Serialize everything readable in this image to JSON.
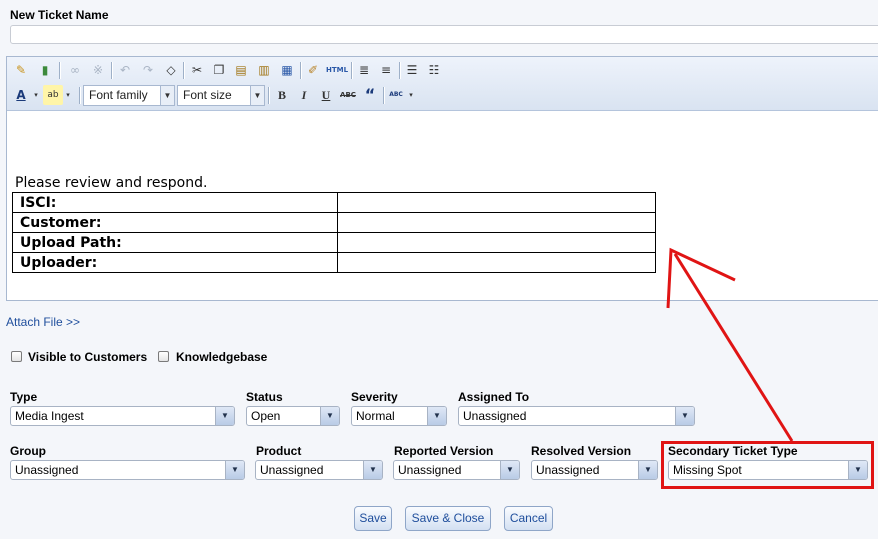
{
  "ticket_name": {
    "label": "New Ticket Name",
    "value": "",
    "placeholder": ""
  },
  "toolbar": {
    "row1_icons": [
      "pencil-icon",
      "books-icon",
      "link-icon",
      "unlink-icon",
      "undo-icon",
      "redo-icon",
      "eraser-icon",
      "cut-icon",
      "copy-icon",
      "paste-icon",
      "paste-text-icon",
      "paste-word-icon",
      "cleanup-brush-icon",
      "html-icon",
      "outdent-icon",
      "indent-icon",
      "bullet-list-icon",
      "numbered-list-icon"
    ],
    "font_family": "Font family",
    "font_size": "Font size",
    "html_label": "HTML",
    "bold": "B",
    "italic": "I",
    "underline": "U",
    "strikethrough": "ABC",
    "quote": "“",
    "spellcheck": "ABC"
  },
  "editor": {
    "intro": "Please review and respond.",
    "table_rows": [
      {
        "label": "ISCI:",
        "value": ""
      },
      {
        "label": "Customer:",
        "value": ""
      },
      {
        "label": "Upload Path:",
        "value": ""
      },
      {
        "label": "Uploader:",
        "value": ""
      }
    ]
  },
  "attach_link": "Attach File >>",
  "checkboxes": {
    "visible": "Visible to Customers",
    "knowledgebase": "Knowledgebase"
  },
  "fields": {
    "type": {
      "label": "Type",
      "value": "Media Ingest"
    },
    "status": {
      "label": "Status",
      "value": "Open"
    },
    "severity": {
      "label": "Severity",
      "value": "Normal"
    },
    "assigned_to": {
      "label": "Assigned To",
      "value": "Unassigned"
    },
    "group": {
      "label": "Group",
      "value": "Unassigned"
    },
    "product": {
      "label": "Product",
      "value": "Unassigned"
    },
    "reported_version": {
      "label": "Reported Version",
      "value": "Unassigned"
    },
    "resolved_version": {
      "label": "Resolved Version",
      "value": "Unassigned"
    },
    "secondary_type": {
      "label": "Secondary Ticket Type",
      "value": "Missing Spot"
    }
  },
  "buttons": {
    "save": "Save",
    "save_close": "Save & Close",
    "cancel": "Cancel"
  },
  "colors": {
    "annotation": "#e01414",
    "link": "#1f4e9c"
  }
}
